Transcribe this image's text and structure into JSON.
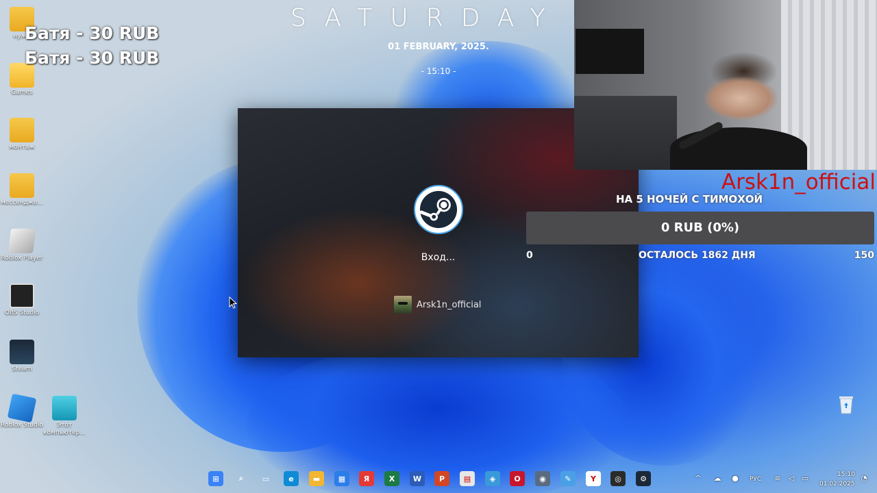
{
  "desktop": {
    "icons": [
      {
        "label": "нужн",
        "icon": "folder-icon"
      },
      {
        "label": "Games",
        "icon": "folder-icon"
      },
      {
        "label": "монтаж",
        "icon": "folder-icon"
      },
      {
        "label": "мессендже...",
        "icon": "folder-icon"
      },
      {
        "label": "Roblox Player",
        "icon": "roblox-player-icon"
      },
      {
        "label": "OBS Studio",
        "icon": "obs-icon"
      },
      {
        "label": "Steam",
        "icon": "steam-icon"
      },
      {
        "label": "Roblox Studio",
        "icon": "roblox-studio-icon"
      },
      {
        "label": "Этот компьютер...",
        "icon": "computer-icon"
      }
    ],
    "recycle_bin_icon": "recycle-bin-icon"
  },
  "overlay": {
    "donations": [
      "Батя - 30 RUB",
      "Батя - 30 RUB"
    ],
    "weekday": "SATURDAY",
    "date": "01 FEBRUARY, 2025.",
    "time": "- 15:10 -"
  },
  "steam_window": {
    "status": "Вход...",
    "account_name": "Arsk1n_official",
    "icon": "steam-logo-icon"
  },
  "goal": {
    "author": "Arsk1n_official",
    "title": "НА 5 НОЧЕЙ С ТИМОХОЙ",
    "progress_label": "0 RUB (0%)",
    "progress_fraction": 0,
    "min": "0",
    "remaining": "ОСТАЛОСЬ 1862 ДНЯ",
    "max": "150",
    "colors": {
      "bar": "#4b4b4e",
      "fill": "#2fbf4a",
      "author": "#cc1111"
    }
  },
  "taskbar": {
    "apps": [
      {
        "name": "start-icon",
        "color": "#3b82f6"
      },
      {
        "name": "search-icon",
        "color": "transparent"
      },
      {
        "name": "task-view-icon",
        "color": "transparent"
      },
      {
        "name": "edge-icon",
        "color": "#0f8bd6"
      },
      {
        "name": "file-explorer-icon",
        "color": "#f2b632"
      },
      {
        "name": "store-icon",
        "color": "#2b7de9"
      },
      {
        "name": "yandex-icon",
        "color": "#e53935"
      },
      {
        "name": "excel-icon",
        "color": "#1d7a45"
      },
      {
        "name": "word-icon",
        "color": "#2b5cb8"
      },
      {
        "name": "powerpoint-icon",
        "color": "#d24726"
      },
      {
        "name": "printer-icon",
        "color": "#e6e6e6"
      },
      {
        "name": "network-app-icon",
        "color": "#3a9ad9"
      },
      {
        "name": "opera-icon",
        "color": "#c7162b"
      },
      {
        "name": "camera-icon",
        "color": "#5a6b80"
      },
      {
        "name": "paint-icon",
        "color": "#4aa0e6"
      },
      {
        "name": "yandex-browser-icon",
        "color": "#ffffff"
      },
      {
        "name": "obs-taskbar-icon",
        "color": "#2b2b2b"
      },
      {
        "name": "steam-taskbar-icon",
        "color": "#1b2838"
      }
    ],
    "tray": {
      "language": "РУС",
      "clock_time": "15:10",
      "clock_date": "01.02.2025"
    }
  }
}
